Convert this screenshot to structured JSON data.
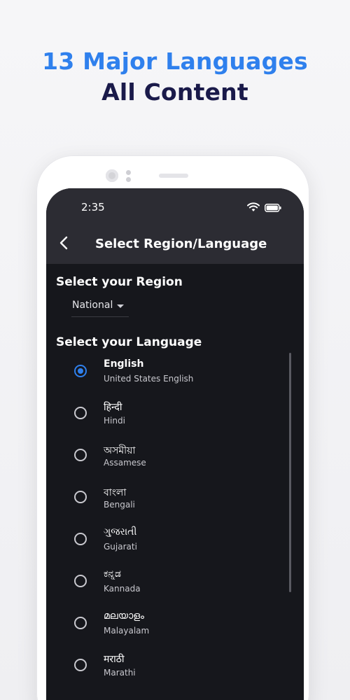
{
  "headline": {
    "line1": "13 Major Languages",
    "line2": "All Content"
  },
  "status_bar": {
    "time": "2:35",
    "icons": [
      "wifi-icon",
      "battery-icon"
    ]
  },
  "app_bar": {
    "back_icon": "chevron-left-icon",
    "title": "Select Region/Language"
  },
  "region": {
    "heading": "Select your Region",
    "selected": "National"
  },
  "language": {
    "heading": "Select your Language",
    "items": [
      {
        "native": "English",
        "english": "United States English",
        "selected": true
      },
      {
        "native": "हिन्दी",
        "english": "Hindi",
        "selected": false
      },
      {
        "native": "অসমীয়া",
        "english": "Assamese",
        "selected": false
      },
      {
        "native": "বাংলা",
        "english": "Bengali",
        "selected": false
      },
      {
        "native": "ગુજરાતી",
        "english": "Gujarati",
        "selected": false
      },
      {
        "native": "ಕನ್ನಡ",
        "english": "Kannada",
        "selected": false
      },
      {
        "native": "മലയാളം",
        "english": "Malayalam",
        "selected": false
      },
      {
        "native": "मराठी",
        "english": "Marathi",
        "selected": false
      }
    ]
  },
  "colors": {
    "accent": "#2f80ed",
    "headline_dark": "#1a1a4a",
    "screen_bg": "#16171c",
    "appbar_bg": "#2c2c33"
  }
}
